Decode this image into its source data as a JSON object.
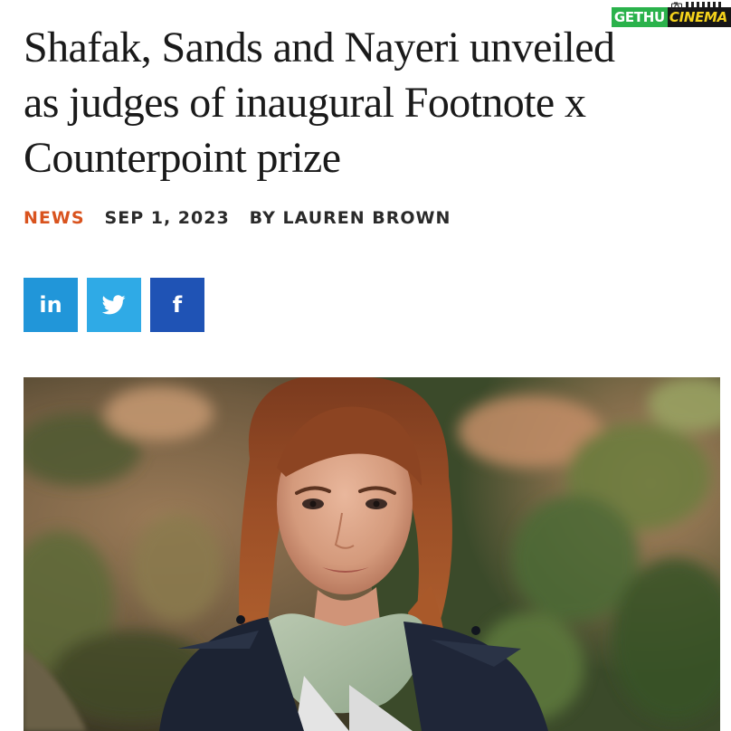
{
  "watermark": {
    "part1": "GETHU",
    "part2": "CINEMA"
  },
  "article": {
    "title_lines": [
      "Shafak, Sands and Nayeri unveiled",
      "as judges of inaugural Footnote x",
      "Counterpoint prize"
    ],
    "category": "NEWS",
    "date": "SEP 1, 2023",
    "byline": "BY LAUREN BROWN"
  },
  "share": {
    "linkedin_label": "in",
    "twitter_icon": "twitter-bird-icon",
    "facebook_label": "f"
  },
  "colors": {
    "category": "#d9531e",
    "linkedin": "#2196d9",
    "twitter": "#2faae6",
    "facebook": "#1f53b5"
  }
}
